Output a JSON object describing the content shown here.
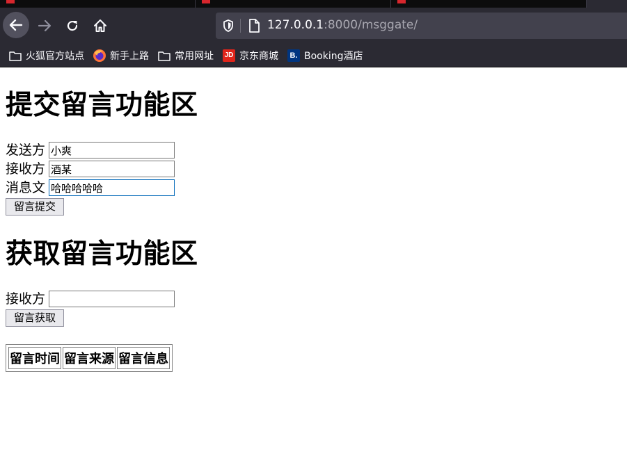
{
  "browser": {
    "url_host": "127.0.0.1",
    "url_rest": ":8000/msggate/",
    "bookmarks": [
      {
        "label": "火狐官方站点",
        "icon": "folder-icon"
      },
      {
        "label": "新手上路",
        "icon": "firefox-icon"
      },
      {
        "label": "常用网址",
        "icon": "folder-icon"
      },
      {
        "label": "京东商城",
        "icon": "jd-icon",
        "badge": "JD"
      },
      {
        "label": "Booking酒店",
        "icon": "booking-icon",
        "badge": "B."
      }
    ]
  },
  "submit_section": {
    "title": "提交留言功能区",
    "sender_label": "发送方",
    "sender_value": "小爽",
    "receiver_label": "接收方",
    "receiver_value": "酒某",
    "message_label": "消息文",
    "message_value": "哈哈哈哈哈",
    "submit_button": "留言提交"
  },
  "fetch_section": {
    "title": "获取留言功能区",
    "receiver_label": "接收方",
    "receiver_value": "",
    "fetch_button": "留言获取"
  },
  "messages_table": {
    "headers": [
      "留言时间",
      "留言来源",
      "留言信息"
    ]
  },
  "colors": {
    "chrome_bg": "#2b2a33",
    "urlbar_bg": "#42414d",
    "focus_border": "#0067b8"
  }
}
